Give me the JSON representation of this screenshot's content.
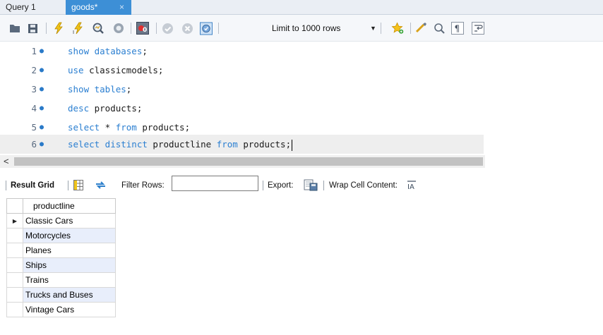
{
  "tabs": [
    {
      "label": "Query 1"
    },
    {
      "label": "goods*",
      "close": "×"
    }
  ],
  "toolbar": {
    "limit_label": "Limit to 1000 rows",
    "limit_arrow": "▼"
  },
  "editor": {
    "lines": [
      {
        "number": "1",
        "marker": "●",
        "parts": [
          {
            "t": "show databases",
            "kw": true
          },
          {
            "t": ";",
            "kw": false
          }
        ]
      },
      {
        "number": "2",
        "marker": "●",
        "parts": [
          {
            "t": "use",
            "kw": true
          },
          {
            "t": " classicmodels;",
            "kw": false
          }
        ]
      },
      {
        "number": "3",
        "marker": "●",
        "parts": [
          {
            "t": "show tables",
            "kw": true
          },
          {
            "t": ";",
            "kw": false
          }
        ]
      },
      {
        "number": "4",
        "marker": "●",
        "parts": [
          {
            "t": "desc",
            "kw": true
          },
          {
            "t": " products;",
            "kw": false
          }
        ]
      },
      {
        "number": "5",
        "marker": "●",
        "parts": [
          {
            "t": "select",
            "kw": true
          },
          {
            "t": " * ",
            "kw": false
          },
          {
            "t": "from",
            "kw": true
          },
          {
            "t": " products;",
            "kw": false
          }
        ]
      },
      {
        "number": "6",
        "marker": "●",
        "parts": [
          {
            "t": "select distinct",
            "kw": true
          },
          {
            "t": " productline ",
            "kw": false
          },
          {
            "t": "from",
            "kw": true
          },
          {
            "t": " products;",
            "kw": false
          }
        ]
      }
    ],
    "scroll_left": "<"
  },
  "result_toolbar": {
    "result_grid": "Result Grid",
    "filter_rows": "Filter Rows:",
    "filter_value": "",
    "export": "Export:",
    "wrap_cell": "Wrap Cell Content:"
  },
  "grid": {
    "column": "productline",
    "row_indicator": "▶",
    "rows": [
      "Classic Cars",
      "Motorcycles",
      "Planes",
      "Ships",
      "Trains",
      "Trucks and Buses",
      "Vintage Cars"
    ]
  },
  "colors": {
    "active_tab": "#3d8fd6",
    "keyword": "#2b7fd1",
    "alt_row": "#e8eefb"
  }
}
